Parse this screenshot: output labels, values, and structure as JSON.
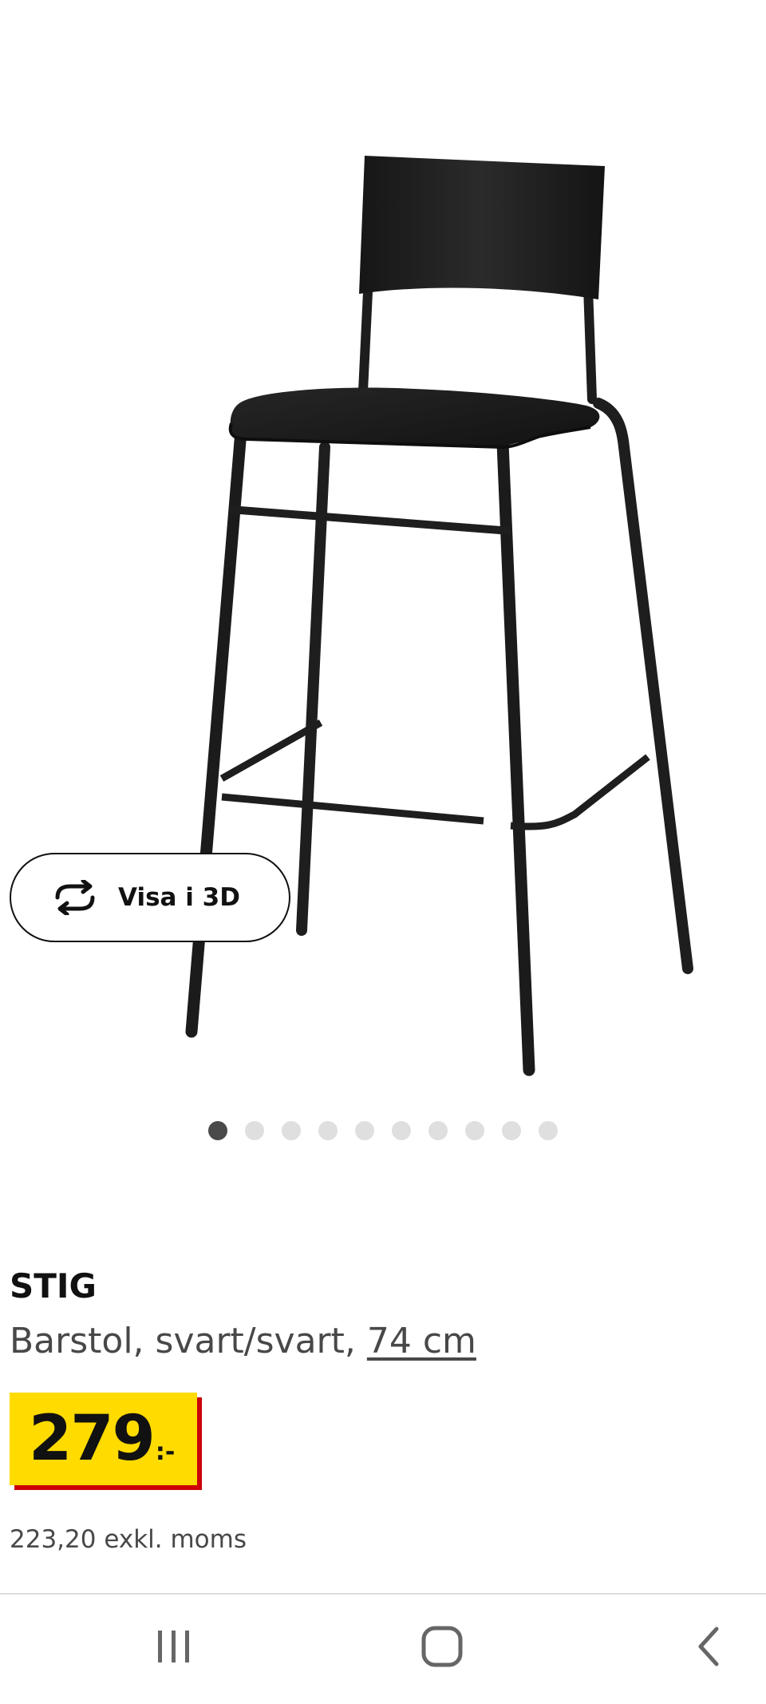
{
  "product": {
    "image_alt": "STIG barstol svart",
    "view_3d_label": "Visa i 3D",
    "carousel": {
      "count": 10,
      "active_index": 0
    },
    "name": "STIG",
    "description": "Barstol, svart/svart, ",
    "size_link": "74 cm",
    "price": "279",
    "price_suffix": ":-",
    "price_exkl": "223,20 exkl. moms"
  },
  "nav": {
    "recent_apps": "recent-apps-icon",
    "home": "home-icon",
    "back": "back-icon"
  },
  "colors": {
    "price_bg": "#ffdb00",
    "price_shadow": "#cc0008",
    "dot_active": "#4a4a4a",
    "dot_inactive": "#dfdfdf"
  }
}
